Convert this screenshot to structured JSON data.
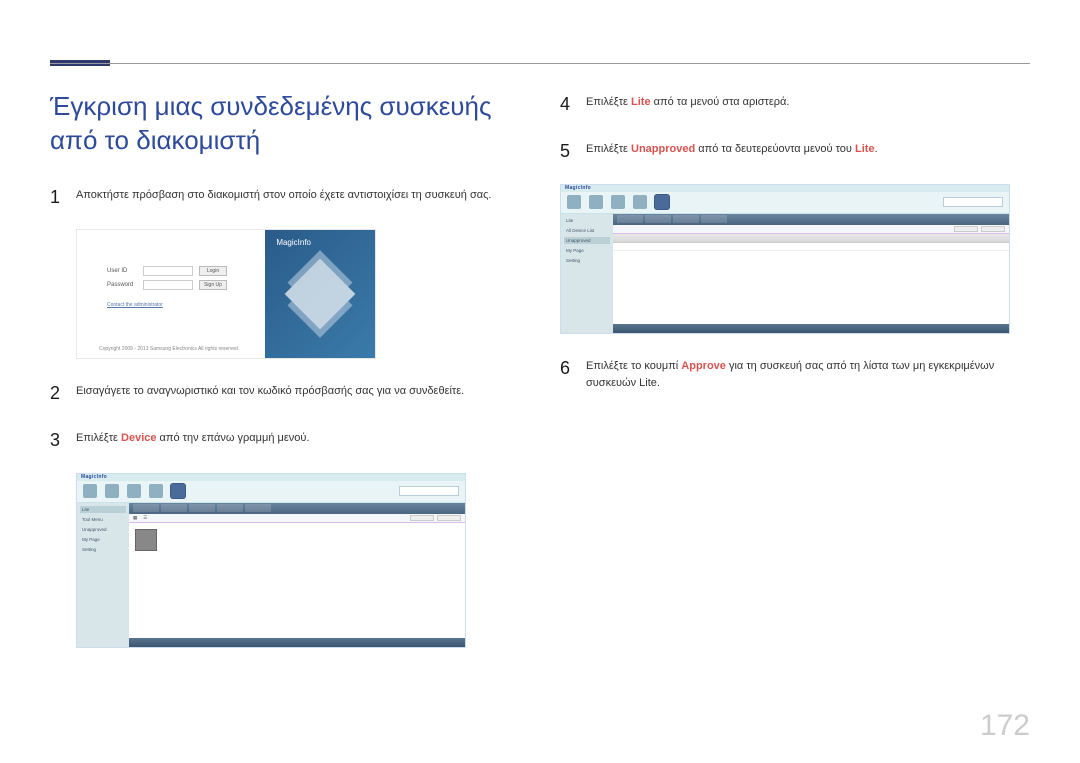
{
  "page_number": "172",
  "section_title": "Έγκριση μιας συνδεδεμένης συσκευής από το διακομιστή",
  "steps": {
    "s1": {
      "num": "1",
      "text": "Αποκτήστε πρόσβαση στο διακομιστή στον οποίο έχετε αντιστοιχίσει τη συσκευή σας."
    },
    "s2": {
      "num": "2",
      "text": "Εισαγάγετε το αναγνωριστικό και τον κωδικό πρόσβασής σας για να συνδεθείτε."
    },
    "s3": {
      "num": "3",
      "prefix": "Επιλέξτε ",
      "hl": "Device",
      "suffix": " από την επάνω γραμμή μενού."
    },
    "s4": {
      "num": "4",
      "prefix": "Επιλέξτε ",
      "hl": "Lite",
      "suffix": " από τα μενού στα αριστερά."
    },
    "s5": {
      "num": "5",
      "prefix": "Επιλέξτε ",
      "hl": "Unapproved",
      "suffix_pre": " από τα δευτερεύοντα μενού του ",
      "hl2": "Lite",
      "suffix_post": "."
    },
    "s6": {
      "num": "6",
      "prefix": "Επιλέξτε το κουμπί ",
      "hl": "Approve",
      "suffix": " για τη συσκευή σας από τη λίστα των μη εγκεκριμένων συσκευών Lite."
    }
  },
  "login_shot": {
    "brand": "MagicInfo",
    "user_label": "User ID",
    "pass_label": "Password",
    "login_btn": "Login",
    "signup_btn": "Sign Up",
    "contact_link": "Contact the administrator",
    "copyright": "Copyright 2009 - 2013 Samsung Electronics All rights reserved."
  },
  "app_shot1": {
    "brand": "MagicInfo",
    "side_items": [
      "Lite",
      "Tool Menu",
      "Unapproved",
      "My Page",
      "Setting"
    ]
  },
  "app_shot2": {
    "brand": "MagicInfo",
    "side_items": [
      "Lite",
      "All Device List",
      "Unapproved",
      "My Page",
      "Setting"
    ]
  }
}
